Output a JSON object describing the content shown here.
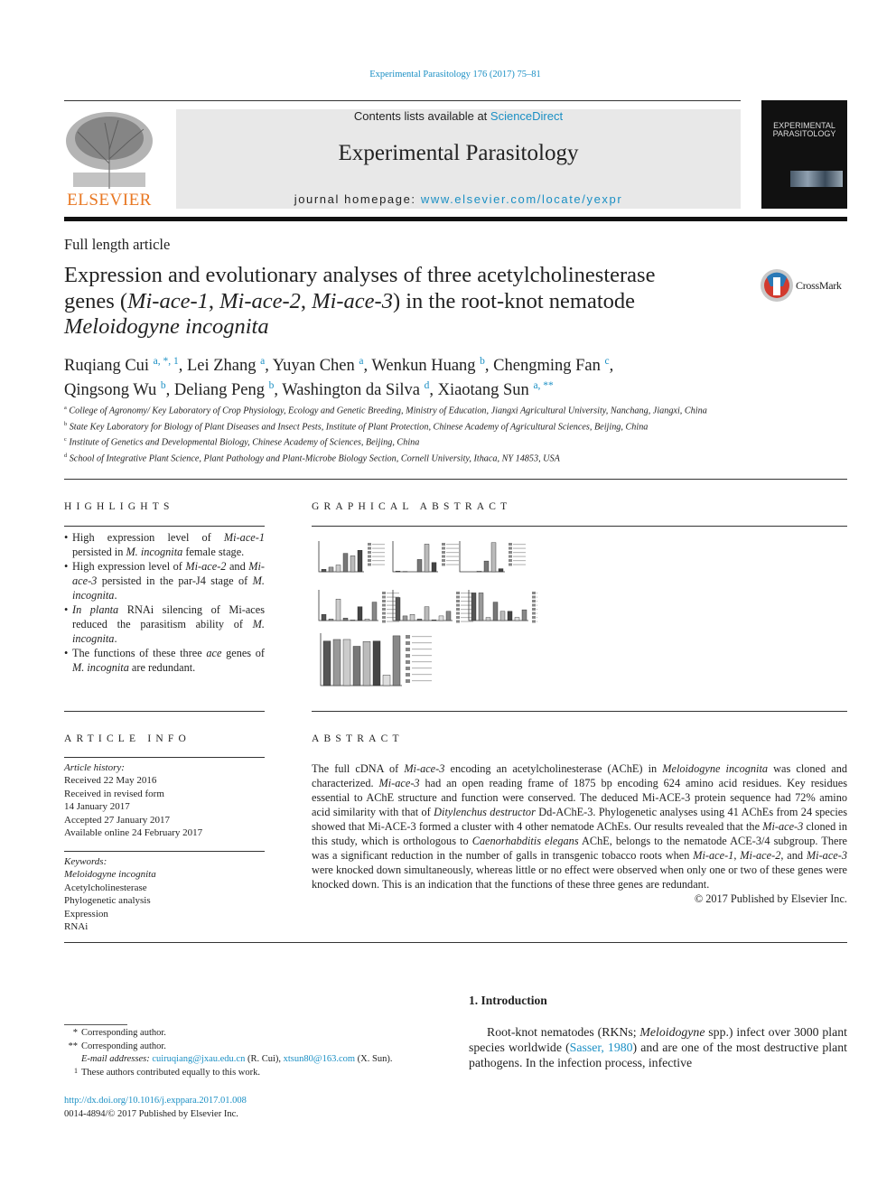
{
  "journal_ref": "Experimental Parasitology 176 (2017) 75–81",
  "header": {
    "contents_prefix": "Contents lists available at ",
    "contents_link": "ScienceDirect",
    "journal_title": "Experimental Parasitology",
    "homepage_prefix": "journal homepage: ",
    "homepage_link": "www.elsevier.com/locate/yexpr",
    "publisher_logo": "ELSEVIER",
    "cover_title": "EXPERIMENTAL PARASITOLOGY"
  },
  "article_type": "Full length article",
  "title": {
    "line1": "Expression and evolutionary analyses of three acetylcholinesterase",
    "line2_pre": "genes (",
    "gene1": "Mi-ace-1",
    "gene2": "Mi-ace-2",
    "gene3": "Mi-ace-3",
    "line2_post": ") in the root-knot nematode",
    "line3": "Meloidogyne incognita",
    "sep": ", "
  },
  "crossmark_label": "CrossMark",
  "authors": [
    {
      "name": "Ruqiang Cui",
      "aff": "a, *, 1"
    },
    {
      "name": "Lei Zhang",
      "aff": "a"
    },
    {
      "name": "Yuyan Chen",
      "aff": "a"
    },
    {
      "name": "Wenkun Huang",
      "aff": "b"
    },
    {
      "name": "Chengming Fan",
      "aff": "c"
    },
    {
      "name": "Qingsong Wu",
      "aff": "b"
    },
    {
      "name": "Deliang Peng",
      "aff": "b"
    },
    {
      "name": "Washington da Silva",
      "aff": "d"
    },
    {
      "name": "Xiaotang Sun",
      "aff": "a, **"
    }
  ],
  "affiliations": [
    {
      "key": "a",
      "text": "College of Agronomy/ Key Laboratory of Crop Physiology, Ecology and Genetic Breeding, Ministry of Education, Jiangxi Agricultural University, Nanchang, Jiangxi, China"
    },
    {
      "key": "b",
      "text": "State Key Laboratory for Biology of Plant Diseases and Insect Pests, Institute of Plant Protection, Chinese Academy of Agricultural Sciences, Beijing, China"
    },
    {
      "key": "c",
      "text": "Institute of Genetics and Developmental Biology, Chinese Academy of Sciences, Beijing, China"
    },
    {
      "key": "d",
      "text": "School of Integrative Plant Science, Plant Pathology and Plant-Microbe Biology Section, Cornell University, Ithaca, NY 14853, USA"
    }
  ],
  "highlights": {
    "heading": "HIGHLIGHTS",
    "items": [
      {
        "a": "High expression level of ",
        "i1": "Mi-ace-1",
        "b": " persisted in ",
        "i2": "M. incognita",
        "c": " female stage."
      },
      {
        "a": "High expression level of ",
        "i1": "Mi-ace-2",
        "b": " and ",
        "i2": "Mi-ace-3",
        "c": " persisted in the par-J4 stage of ",
        "i3": "M. incognita",
        "d": "."
      },
      {
        "i0": "In planta",
        "a": " RNAi silencing of Mi-aces reduced the parasitism ability of ",
        "i1": "M. incognita",
        "b": "."
      },
      {
        "a": "The functions of these three ",
        "i1": "ace",
        "b": " genes of ",
        "i2": "M. incognita",
        "c": " are redundant."
      }
    ]
  },
  "graphical_abstract": {
    "heading": "GRAPHICAL ABSTRACT",
    "panels": [
      [
        8,
        15,
        22,
        60,
        52,
        70
      ],
      [
        2,
        1,
        0,
        40,
        90,
        30
      ],
      [
        0,
        0,
        2,
        35,
        95,
        10
      ],
      [
        20,
        5,
        70,
        8,
        2,
        45,
        5,
        60
      ],
      [
        75,
        15,
        20,
        5,
        45,
        2,
        15,
        30
      ],
      [
        90,
        90,
        10,
        60,
        30,
        30,
        10,
        35
      ],
      [
        85,
        88,
        88,
        75,
        84,
        85,
        20,
        95
      ]
    ]
  },
  "article_info": {
    "heading": "ARTICLE INFO",
    "history_label": "Article history:",
    "history": [
      "Received 22 May 2016",
      "Received in revised form",
      "14 January 2017",
      "Accepted 27 January 2017",
      "Available online 24 February 2017"
    ],
    "keywords_label": "Keywords:",
    "keywords": [
      "Meloidogyne incognita",
      "Acetylcholinesterase",
      "Phylogenetic analysis",
      "Expression",
      "RNAi"
    ]
  },
  "abstract": {
    "heading": "ABSTRACT",
    "parts": [
      {
        "t": "The full cDNA of "
      },
      {
        "i": "Mi-ace-3"
      },
      {
        "t": " encoding an acetylcholinesterase (AChE) in "
      },
      {
        "i": "Meloidogyne incognita"
      },
      {
        "t": " was cloned and characterized. "
      },
      {
        "i": "Mi-ace-3"
      },
      {
        "t": " had an open reading frame of 1875 bp encoding 624 amino acid residues. Key residues essential to AChE structure and function were conserved. The deduced Mi-ACE-3 protein sequence had 72% amino acid similarity with that of "
      },
      {
        "i": "Ditylenchus destructor"
      },
      {
        "t": " Dd-AChE-3. Phylogenetic analyses using 41 AChEs from 24 species showed that Mi-ACE-3 formed a cluster with 4 other nematode AChEs. Our results revealed that the "
      },
      {
        "i": "Mi-ace-3"
      },
      {
        "t": " cloned in this study, which is orthologous to "
      },
      {
        "i": "Caenorhabditis elegans"
      },
      {
        "t": " AChE, belongs to the nematode ACE-3/4 subgroup. There was a significant reduction in the number of galls in transgenic tobacco roots when "
      },
      {
        "i": "Mi-ace-1"
      },
      {
        "t": ", "
      },
      {
        "i": "Mi-ace-2"
      },
      {
        "t": ", and "
      },
      {
        "i": "Mi-ace-3"
      },
      {
        "t": " were knocked down simultaneously, whereas little or no effect were observed when only one or two of these genes were knocked down. This is an indication that the functions of these three genes are redundant."
      }
    ],
    "copyright": "© 2017 Published by Elsevier Inc."
  },
  "introduction": {
    "heading": "1.  Introduction",
    "t1": "Root-knot nematodes (RKNs; ",
    "i1": "Meloidogyne",
    "t2": " spp.) infect over 3000 plant species worldwide (",
    "cite": "Sasser, 1980",
    "t3": ") and are one of the most destructive plant pathogens. In the infection process, infective"
  },
  "footnotes": {
    "star1_mark": "*",
    "star1": "Corresponding author.",
    "star2_mark": "**",
    "star2": "Corresponding author.",
    "email_label": "E-mail addresses: ",
    "email1": "cuiruqiang@jxau.edu.cn",
    "email1_who": " (R. Cui), ",
    "email2": "xtsun80@163.com",
    "email2_who": " (X. Sun).",
    "one_mark": "1",
    "one": "These authors contributed equally to this work."
  },
  "doi": "http://dx.doi.org/10.1016/j.exppara.2017.01.008",
  "issn_line": "0014-4894/© 2017 Published by Elsevier Inc."
}
